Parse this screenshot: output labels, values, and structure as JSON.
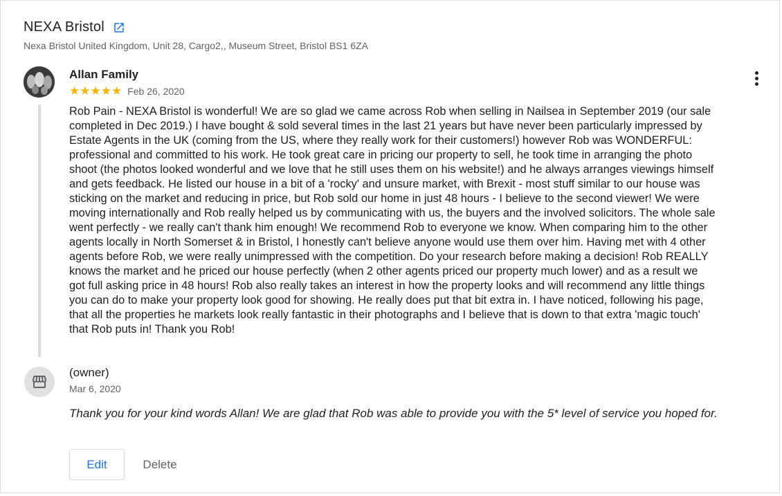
{
  "business": {
    "name": "NEXA Bristol",
    "address": "Nexa Bristol United Kingdom, Unit 28, Cargo2,, Museum Street, Bristol BS1 6ZA"
  },
  "review": {
    "author": "Allan Family",
    "stars": "★★★★★",
    "rating": 5,
    "date": "Feb 26, 2020",
    "text": "Rob Pain - NEXA Bristol is wonderful! We are so glad we came across Rob when selling in Nailsea in September 2019 (our sale completed in Dec 2019.) I have bought & sold several times in the last 21 years but have never been particularly impressed by Estate Agents in the UK (coming from the US, where they really work for their customers!) however Rob was WONDERFUL: professional and committed to his work. He took great care in pricing our property to sell, he took time in arranging the photo shoot (the photos looked wonderful and we love that he still uses them on his website!) and he always arranges viewings himself and gets feedback. He listed our house in a bit of a 'rocky' and unsure market, with Brexit - most stuff similar to our house was sticking on the market and reducing in price, but Rob sold our home in just 48 hours - I believe to the second viewer! We were moving internationally and Rob really helped us by communicating with us, the buyers and the involved solicitors. The whole sale went perfectly - we really can't thank him enough! We recommend Rob to everyone we know. When comparing him to the other agents locally in North Somerset & in Bristol, I honestly can't believe anyone would use them over him. Having met with 4 other agents before Rob, we were really unimpressed with the competition. Do your research before making a decision! Rob REALLY knows the market and he priced our house perfectly (when 2 other agents priced our property much lower) and as a result we got full asking price in 48 hours! Rob also really takes an interest in how the property looks and will recommend any little things you can do to make your property look good for showing. He really does put that bit extra in. I have noticed, following his page, that all the properties he markets look really fantastic in their photographs and I believe that is down to that extra 'magic touch' that Rob puts in! Thank you Rob!"
  },
  "reply": {
    "label": "(owner)",
    "date": "Mar 6, 2020",
    "text": "Thank you for your kind words Allan! We are glad that Rob was able to provide you with the 5* level of service you hoped for."
  },
  "actions": {
    "edit_label": "Edit",
    "delete_label": "Delete"
  },
  "icons": {
    "external_link": "open-in-new-icon",
    "more": "more-vert-icon",
    "owner": "storefront-icon",
    "accent": "#1a73e8",
    "star_color": "#f4b400"
  }
}
